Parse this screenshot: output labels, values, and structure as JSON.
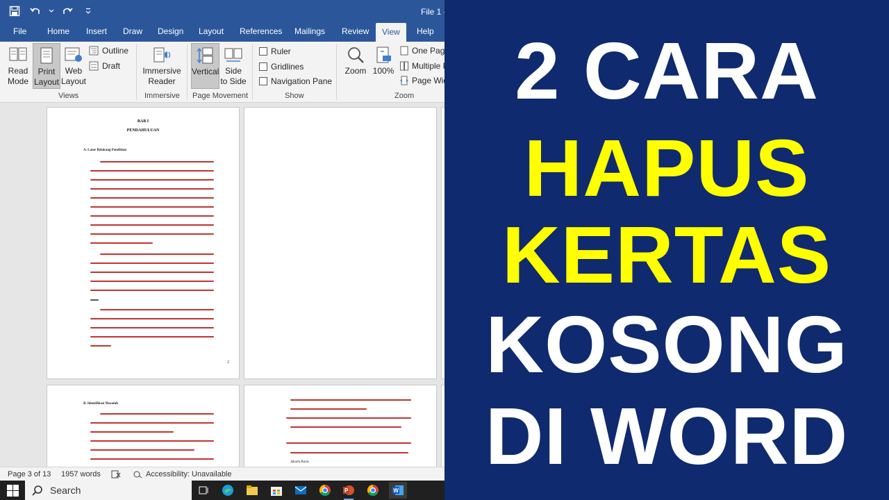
{
  "window": {
    "doc_title": "File 1 -"
  },
  "tabs": [
    "File",
    "Home",
    "Insert",
    "Draw",
    "Design",
    "Layout",
    "References",
    "Mailings",
    "Review",
    "View",
    "Help"
  ],
  "ribbon": {
    "views": {
      "read_mode": [
        "Read",
        "Mode"
      ],
      "print_layout": [
        "Print",
        "Layout"
      ],
      "web_layout": [
        "Web",
        "Layout"
      ],
      "outline": "Outline",
      "draft": "Draft",
      "label": "Views"
    },
    "immersive": {
      "reader": [
        "Immersive",
        "Reader"
      ],
      "label": "Immersive"
    },
    "page_movement": {
      "vertical": "Vertical",
      "side_to_side": [
        "Side",
        "to Side"
      ],
      "label": "Page Movement"
    },
    "show": {
      "ruler": "Ruler",
      "gridlines": "Gridlines",
      "navigation_pane": "Navigation Pane",
      "label": "Show"
    },
    "zoom": {
      "zoom": "Zoom",
      "percent": "100%",
      "one_page": "One Page",
      "multiple_pages": "Multiple P",
      "page_width": "Page Widt",
      "label": "Zoom"
    }
  },
  "document": {
    "page1": {
      "chapter": "BAB I",
      "title": "PENDAHULUAN",
      "section": "A.  Latar Belakang Penelitian",
      "page_number": "2"
    },
    "page3": {
      "section": "B.  Identifikasi Masalah"
    },
    "page4": {
      "line1": "Jakarta Barat."
    }
  },
  "statusbar": {
    "page": "Page 3 of 13",
    "words": "1957 words",
    "accessibility": "Accessibility: Unavailable"
  },
  "taskbar": {
    "search_placeholder": "Search"
  },
  "banner": {
    "line1": "2 CARA",
    "line2": "HAPUS",
    "line3": "KERTAS",
    "line4": "KOSONG",
    "line5": "DI WORD",
    "background": "#0f2a6e",
    "highlight_color": "#ffff00"
  }
}
